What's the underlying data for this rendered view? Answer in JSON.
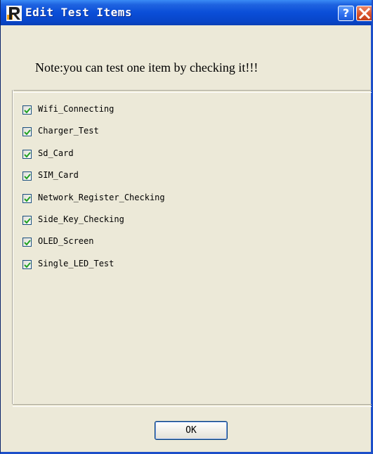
{
  "window": {
    "title": "Edit Test Items",
    "title_color": "#ffffff",
    "titlebar_color": "#0a4ed8",
    "background_color": "#ece9d8"
  },
  "icons": {
    "app": "app-r-icon",
    "help": "help-icon",
    "close": "close-icon",
    "check": "check-icon"
  },
  "titlebar_buttons": {
    "help_label": "?"
  },
  "note": {
    "text": "Note:you can test one item by checking it!!!"
  },
  "test_items": [
    {
      "label": "Wifi_Connecting",
      "checked": true
    },
    {
      "label": "Charger_Test",
      "checked": true
    },
    {
      "label": "Sd_Card",
      "checked": true
    },
    {
      "label": "SIM_Card",
      "checked": true
    },
    {
      "label": "Network_Register_Checking",
      "checked": true
    },
    {
      "label": "Side_Key_Checking",
      "checked": true
    },
    {
      "label": "OLED_Screen",
      "checked": true
    },
    {
      "label": "Single_LED_Test",
      "checked": true
    }
  ],
  "footer": {
    "ok_label": "OK"
  },
  "colors": {
    "check_mark": "#21a121",
    "checkbox_border": "#1c5180",
    "close_button": "#d9512a"
  }
}
